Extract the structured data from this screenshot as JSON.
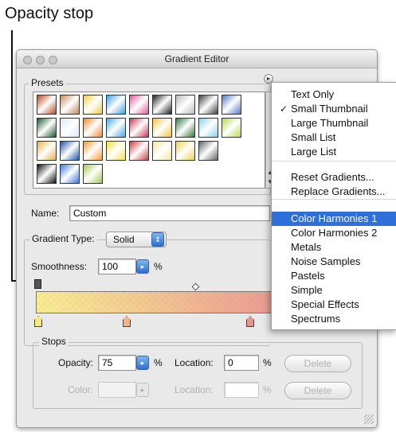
{
  "callout": {
    "label": "Opacity stop"
  },
  "window": {
    "title": "Gradient Editor"
  },
  "presets": {
    "legend": "Presets",
    "swatches": [
      [
        "#b84a1e",
        "#c28a5c",
        "#f0d040",
        "#3aa0e0",
        "#e05a9a",
        "#222222",
        "#bbbbbb",
        "#444444",
        "#5878c8"
      ],
      [
        "#1a5a2a",
        "#dfe7f0",
        "#f08a2a",
        "#44aadd",
        "#cc3355",
        "#f7c23a",
        "#2f7a3a",
        "#8ad0e8",
        "#b7d84a"
      ],
      [
        "#e8b04a",
        "#2255aa",
        "#ff9a2a",
        "#f3e04a",
        "#c94040",
        "#f2e6a0",
        "#f2cf50",
        "#666666"
      ],
      [
        "#111111",
        "#3b79d6",
        "#a8c84a"
      ]
    ]
  },
  "menu": {
    "items": [
      {
        "label": "Text Only",
        "checked": false,
        "selected": false
      },
      {
        "label": "Small Thumbnail",
        "checked": true,
        "selected": false
      },
      {
        "label": "Large Thumbnail",
        "checked": false,
        "selected": false
      },
      {
        "label": "Small List",
        "checked": false,
        "selected": false
      },
      {
        "label": "Large List",
        "checked": false,
        "selected": false
      },
      {
        "label": "Reset Gradients...",
        "checked": false,
        "selected": false
      },
      {
        "label": "Replace Gradients...",
        "checked": false,
        "selected": false
      },
      {
        "label": "Color Harmonies 1",
        "checked": false,
        "selected": true
      },
      {
        "label": "Color Harmonies 2",
        "checked": false,
        "selected": false
      },
      {
        "label": "Metals",
        "checked": false,
        "selected": false
      },
      {
        "label": "Noise Samples",
        "checked": false,
        "selected": false
      },
      {
        "label": "Pastels",
        "checked": false,
        "selected": false
      },
      {
        "label": "Simple",
        "checked": false,
        "selected": false
      },
      {
        "label": "Special Effects",
        "checked": false,
        "selected": false
      },
      {
        "label": "Spectrums",
        "checked": false,
        "selected": false
      }
    ],
    "checkmark": "✓",
    "selected_color": "#2e6fd9"
  },
  "name_field": {
    "label": "Name:",
    "value": "Custom"
  },
  "gradient_type": {
    "label": "Gradient Type:",
    "value": "Solid"
  },
  "smoothness": {
    "label": "Smoothness:",
    "value": "100",
    "unit": "%"
  },
  "gradient": {
    "start_color": "#f8ea7a",
    "end_color": "#e8948a"
  },
  "stops": {
    "legend": "Stops",
    "opacity_label": "Opacity:",
    "opacity_value": "75",
    "opacity_unit": "%",
    "location_label": "Location:",
    "location_value": "0",
    "location_unit": "%",
    "delete_label": "Delete",
    "color_label": "Color:",
    "color_location_label": "Location:",
    "color_location_unit": "%",
    "color_delete_label": "Delete"
  }
}
